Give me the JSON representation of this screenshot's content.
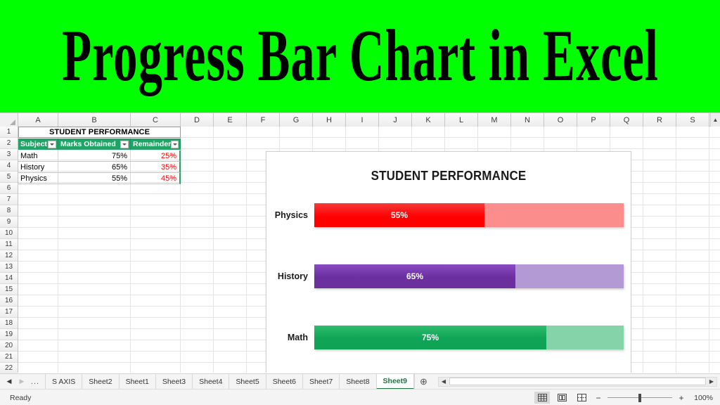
{
  "banner": {
    "title": "Progress Bar Chart in Excel",
    "bg_color": "#00FF00",
    "text_color": "#000000"
  },
  "spreadsheet": {
    "column_headers": [
      "A",
      "B",
      "C",
      "D",
      "E",
      "F",
      "G",
      "H",
      "I",
      "J",
      "K",
      "L",
      "M",
      "N",
      "O",
      "P",
      "Q",
      "R",
      "S"
    ],
    "row_numbers": [
      "1",
      "2",
      "3",
      "4",
      "5",
      "6",
      "7",
      "8",
      "9",
      "10",
      "11",
      "12",
      "13",
      "14",
      "15",
      "16",
      "17",
      "18",
      "19",
      "20",
      "21",
      "22"
    ],
    "merged_title": "STUDENT PERFORMANCE",
    "table_headers": [
      "Subject",
      "Marks Obtained",
      "Remainder"
    ],
    "rows": [
      {
        "subject": "Math",
        "marks": "75%",
        "remainder": "25%"
      },
      {
        "subject": "History",
        "marks": "65%",
        "remainder": "35%"
      },
      {
        "subject": "Physics",
        "marks": "55%",
        "remainder": "45%"
      }
    ],
    "header_bg": "#21a366",
    "remainder_text_color": "#ff0000"
  },
  "chart_data": {
    "type": "bar",
    "title": "STUDENT PERFORMANCE",
    "orientation": "horizontal",
    "stacked": true,
    "categories": [
      "Physics",
      "History",
      "Math"
    ],
    "values": [
      55,
      65,
      75
    ],
    "remainders": [
      45,
      35,
      25
    ],
    "data_labels": [
      "55%",
      "65%",
      "75%"
    ],
    "xlabel": "",
    "ylabel": "",
    "xlim": [
      0,
      100
    ],
    "grid": false,
    "legend": "none",
    "series": [
      {
        "name": "Marks Obtained",
        "values": [
          55,
          65,
          75
        ]
      },
      {
        "name": "Remainder",
        "values": [
          45,
          35,
          25
        ]
      }
    ],
    "bar_colors": [
      {
        "category": "Physics",
        "fill": "#ff0000",
        "fill_light": "#f43a3a",
        "remainder": "#fb8d8d"
      },
      {
        "category": "History",
        "fill": "#6b2f9e",
        "fill_light": "#8a4bc4",
        "remainder": "#b49ad4"
      },
      {
        "category": "Math",
        "fill": "#0fa356",
        "fill_light": "#2ebd6e",
        "remainder": "#85d3a8"
      }
    ]
  },
  "tabbar": {
    "nav_prev": "◀",
    "nav_next": "▶",
    "ellipsis": "...",
    "tabs": [
      "S AXIS",
      "Sheet2",
      "Sheet1",
      "Sheet3",
      "Sheet4",
      "Sheet5",
      "Sheet6",
      "Sheet7",
      "Sheet8",
      "Sheet9"
    ],
    "active_tab": "Sheet9",
    "add_sheet": "⊕",
    "active_color": "#217346"
  },
  "statusbar": {
    "ready": "Ready",
    "views": [
      "normal-view",
      "page-layout-view",
      "page-break-view"
    ],
    "zoom_minus": "−",
    "zoom_plus": "+",
    "zoom_level": "100%"
  }
}
